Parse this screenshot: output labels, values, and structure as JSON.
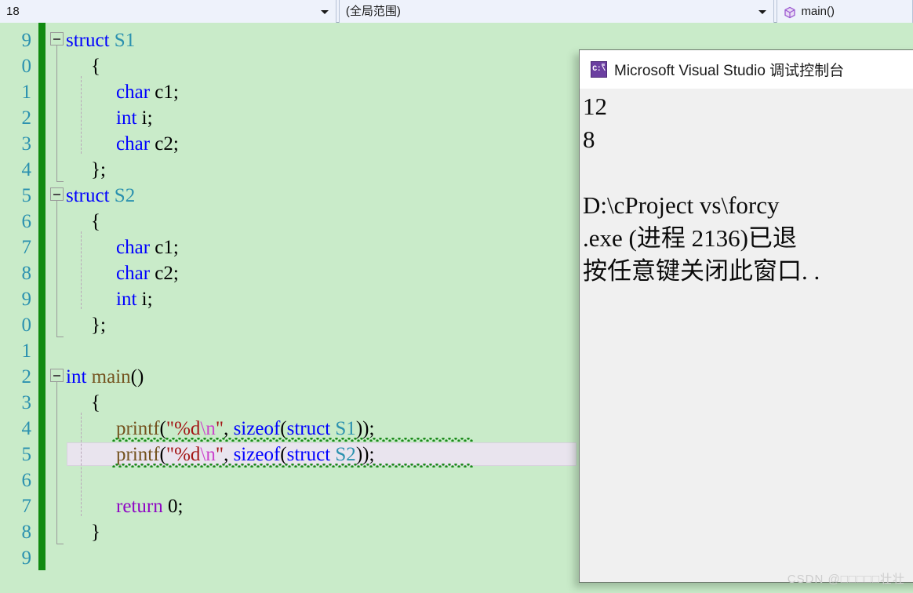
{
  "navbar": {
    "project_selector": {
      "value": "18",
      "icon": "chevron-down-icon"
    },
    "scope_selector": {
      "value": "(全局范围)",
      "icon": "chevron-down-icon"
    },
    "member_selector": {
      "value": "main()",
      "icon": "method-cube-icon"
    }
  },
  "editor": {
    "line_numbers": [
      "9",
      "0",
      "1",
      "2",
      "3",
      "4",
      "5",
      "6",
      "7",
      "8",
      "9",
      "0",
      "1",
      "2",
      "3",
      "4",
      "5",
      "6",
      "7",
      "8",
      "9"
    ],
    "lines": [
      {
        "indent": 0,
        "tokens": [
          {
            "t": "struct",
            "c": "kw"
          },
          {
            "t": " ",
            "c": "pun"
          },
          {
            "t": "S1",
            "c": "type"
          }
        ]
      },
      {
        "indent": 1,
        "tokens": [
          {
            "t": "{",
            "c": "pun"
          }
        ]
      },
      {
        "indent": 2,
        "tokens": [
          {
            "t": "char",
            "c": "kw"
          },
          {
            "t": " c1;",
            "c": "pun"
          }
        ]
      },
      {
        "indent": 2,
        "tokens": [
          {
            "t": "int",
            "c": "kw"
          },
          {
            "t": " i;",
            "c": "pun"
          }
        ]
      },
      {
        "indent": 2,
        "tokens": [
          {
            "t": "char",
            "c": "kw"
          },
          {
            "t": " c2;",
            "c": "pun"
          }
        ]
      },
      {
        "indent": 1,
        "tokens": [
          {
            "t": "};",
            "c": "pun"
          }
        ]
      },
      {
        "indent": 0,
        "tokens": [
          {
            "t": "struct",
            "c": "kw"
          },
          {
            "t": " ",
            "c": "pun"
          },
          {
            "t": "S2",
            "c": "type"
          }
        ]
      },
      {
        "indent": 1,
        "tokens": [
          {
            "t": "{",
            "c": "pun"
          }
        ]
      },
      {
        "indent": 2,
        "tokens": [
          {
            "t": "char",
            "c": "kw"
          },
          {
            "t": " c1;",
            "c": "pun"
          }
        ]
      },
      {
        "indent": 2,
        "tokens": [
          {
            "t": "char",
            "c": "kw"
          },
          {
            "t": " c2;",
            "c": "pun"
          }
        ]
      },
      {
        "indent": 2,
        "tokens": [
          {
            "t": "int",
            "c": "kw"
          },
          {
            "t": " i;",
            "c": "pun"
          }
        ]
      },
      {
        "indent": 1,
        "tokens": [
          {
            "t": "};",
            "c": "pun"
          }
        ]
      },
      {
        "indent": 0,
        "tokens": []
      },
      {
        "indent": 0,
        "tokens": [
          {
            "t": "int",
            "c": "kw"
          },
          {
            "t": " ",
            "c": "pun"
          },
          {
            "t": "main",
            "c": "fn"
          },
          {
            "t": "()",
            "c": "pun"
          }
        ]
      },
      {
        "indent": 1,
        "tokens": [
          {
            "t": "{",
            "c": "pun"
          }
        ]
      },
      {
        "indent": 2,
        "tokens": [
          {
            "t": "printf",
            "c": "fn"
          },
          {
            "t": "(",
            "c": "pun"
          },
          {
            "t": "\"%d",
            "c": "str"
          },
          {
            "t": "\\n",
            "c": "esc"
          },
          {
            "t": "\"",
            "c": "str"
          },
          {
            "t": ", ",
            "c": "pun"
          },
          {
            "t": "sizeof",
            "c": "kw"
          },
          {
            "t": "(",
            "c": "pun"
          },
          {
            "t": "struct",
            "c": "kw"
          },
          {
            "t": " ",
            "c": "pun"
          },
          {
            "t": "S1",
            "c": "type"
          },
          {
            "t": "));",
            "c": "pun"
          }
        ]
      },
      {
        "indent": 2,
        "tokens": [
          {
            "t": "printf",
            "c": "fn"
          },
          {
            "t": "(",
            "c": "pun"
          },
          {
            "t": "\"%d",
            "c": "str"
          },
          {
            "t": "\\n",
            "c": "esc"
          },
          {
            "t": "\"",
            "c": "str"
          },
          {
            "t": ", ",
            "c": "pun"
          },
          {
            "t": "sizeof",
            "c": "kw"
          },
          {
            "t": "(",
            "c": "pun"
          },
          {
            "t": "struct",
            "c": "kw"
          },
          {
            "t": " ",
            "c": "pun"
          },
          {
            "t": "S2",
            "c": "type"
          },
          {
            "t": "));",
            "c": "pun"
          }
        ]
      },
      {
        "indent": 0,
        "tokens": []
      },
      {
        "indent": 2,
        "tokens": [
          {
            "t": "return",
            "c": "ctl"
          },
          {
            "t": " 0;",
            "c": "num"
          }
        ]
      },
      {
        "indent": 1,
        "tokens": [
          {
            "t": "}",
            "c": "pun"
          }
        ]
      },
      {
        "indent": 0,
        "tokens": []
      }
    ],
    "collapse_rows": [
      0,
      6,
      13
    ],
    "current_line_index": 16,
    "squiggle_rows": [
      15,
      16
    ],
    "colors": {
      "background": "#c9ebc9",
      "change_bar": "#108a10",
      "keyword": "#0000ff",
      "type": "#2b91af",
      "function": "#74531f",
      "string": "#a31515",
      "escape": "#cc44cc",
      "control": "#8f08c4",
      "line_number": "#2b91af",
      "squiggle": "#1a8a1a",
      "current_line_fill": "#e9e4ee"
    }
  },
  "console": {
    "title": "Microsoft Visual Studio 调试控制台",
    "icon": "console-cmd-icon",
    "icon_label": "C:\\",
    "output": [
      "12",
      "8",
      "",
      "D:\\cProject vs\\forcy",
      ".exe (进程 2136)已退",
      "按任意键关闭此窗口. ."
    ]
  },
  "watermark": {
    "text": "CSDN @□□□□□壮壮"
  }
}
